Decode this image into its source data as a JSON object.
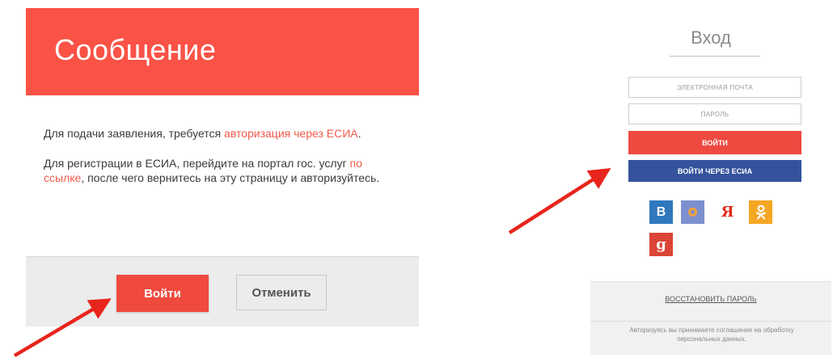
{
  "message_dialog": {
    "title": "Сообщение",
    "paragraph1": {
      "text_before": "Для подачи заявления, требуется ",
      "link": "авторизация через ЕСИА",
      "text_after": "."
    },
    "paragraph2": {
      "text_before": "Для регистрации в ЕСИА, перейдите на портал гос. услуг ",
      "link": "по ссылке",
      "text_after": ", после чего вернитесь на эту страницу и авторизуйтесь."
    },
    "login_button": "Войти",
    "cancel_button": "Отменить"
  },
  "login_panel": {
    "title": "Вход",
    "email_placeholder": "ЭЛЕКТРОННАЯ ПОЧТА",
    "password_placeholder": "ПАРОЛЬ",
    "login_button": "ВОЙТИ",
    "esia_button": "ВОЙТИ ЧЕРЕЗ ЕСИА",
    "social": {
      "vk": "B",
      "yandex": "Я",
      "odnoklassniki": "ok",
      "google": "g"
    },
    "restore_password": "ВОССТАНОВИТЬ ПАРОЛЬ",
    "agreement": "Авторизуясь вы принимаете соглашение на обработку персональных данных."
  },
  "colors": {
    "header_red": "#fb5246",
    "button_red": "#f04a3e",
    "esia_blue": "#34539c",
    "arrow_red": "#e8251c"
  },
  "icons": [
    "vk-icon",
    "mail-ru-icon",
    "yandex-icon",
    "odnoklassniki-icon",
    "google-plus-icon",
    "arrow-icon"
  ]
}
